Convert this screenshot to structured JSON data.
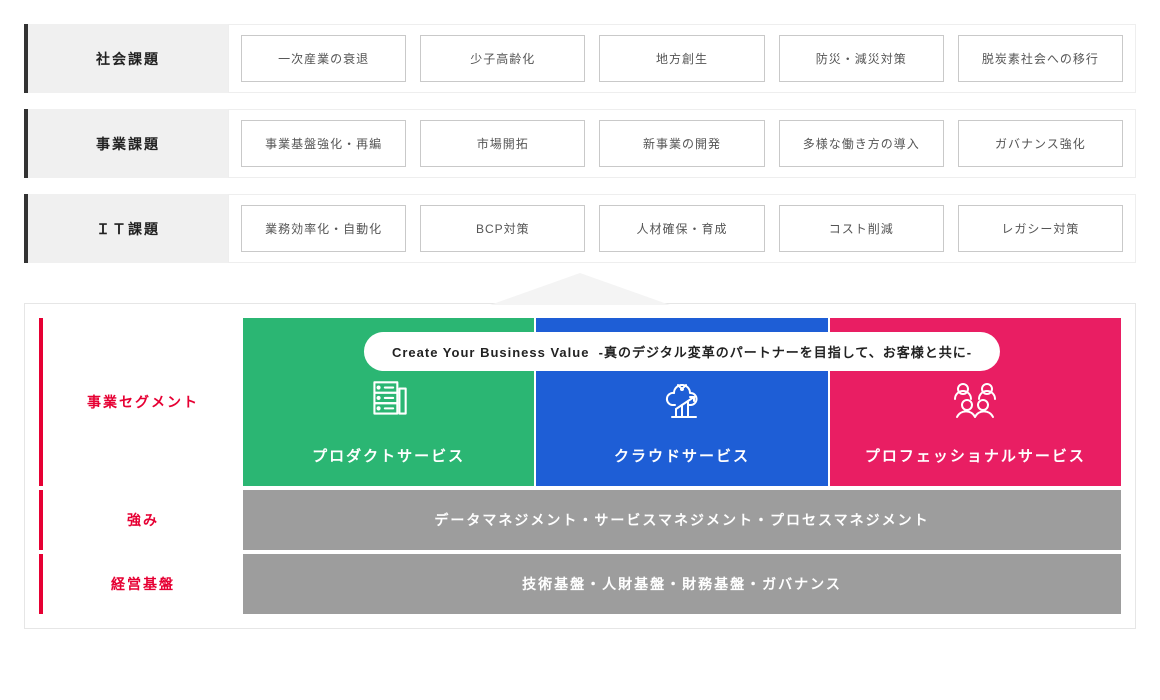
{
  "top_rows": [
    {
      "label": "社会課題",
      "tags": [
        "一次産業の衰退",
        "少子高齢化",
        "地方創生",
        "防災・減災対策",
        "脱炭素社会への移行"
      ]
    },
    {
      "label": "事業課題",
      "tags": [
        "事業基盤強化・再編",
        "市場開拓",
        "新事業の開発",
        "多様な働き方の導入",
        "ガバナンス強化"
      ]
    },
    {
      "label": "ＩＴ課題",
      "tags": [
        "業務効率化・自動化",
        "BCP対策",
        "人材確保・育成",
        "コスト削減",
        "レガシー対策"
      ]
    }
  ],
  "segment_row_label": "事業セグメント",
  "slogan": {
    "main": "Create Your Business Value",
    "sub": "-真のデジタル変革のパートナーを目指して、お客様と共に-"
  },
  "segments": [
    {
      "name": "プロダクトサービス",
      "color": "green",
      "icon": "server-icon"
    },
    {
      "name": "クラウドサービス",
      "color": "blue",
      "icon": "cloud-chart-icon"
    },
    {
      "name": "プロフェッショナルサービス",
      "color": "pink",
      "icon": "people-icon"
    }
  ],
  "strength": {
    "label": "強み",
    "text": "データマネジメント・サービスマネジメント・プロセスマネジメント"
  },
  "foundation": {
    "label": "経営基盤",
    "text": "技術基盤・人財基盤・財務基盤・ガバナンス"
  }
}
